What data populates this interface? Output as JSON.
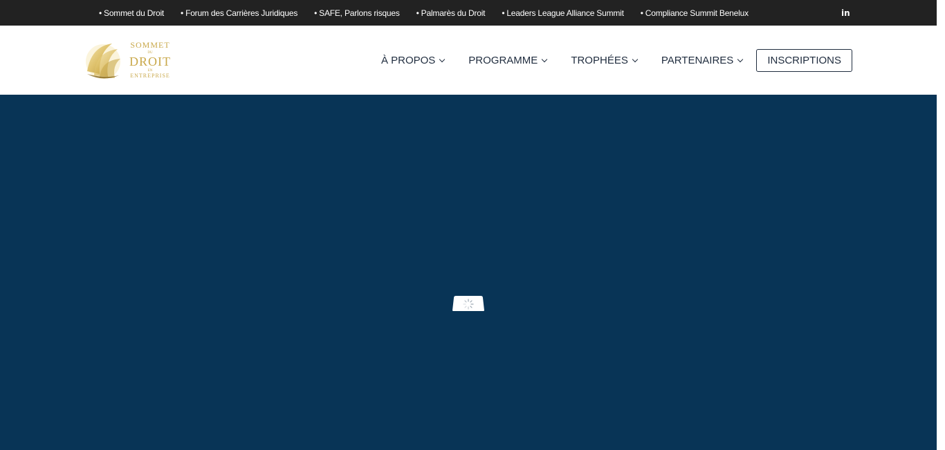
{
  "topbar": {
    "links": [
      {
        "bullet": "•",
        "label": "Sommet du Droit"
      },
      {
        "bullet": "•",
        "label": "Forum des Carrières Juridiques"
      },
      {
        "bullet": "•",
        "label": "SAFE, Parlons risques"
      },
      {
        "bullet": "•",
        "label": "Palmarès du Droit"
      },
      {
        "bullet": "•",
        "label": "Leaders League Alliance Summit"
      },
      {
        "bullet": "•",
        "label": "Compliance Summit Benelux"
      }
    ],
    "social": {
      "icon": "linkedin-icon",
      "label": "in"
    }
  },
  "header": {
    "logo": {
      "line1": "SOMMET",
      "line2": "DU",
      "line3": "DROIT",
      "line4": "EN",
      "line5": "ENTREPRISE"
    },
    "nav": [
      {
        "label": "À PROPOS",
        "icon": "chevron-down-icon"
      },
      {
        "label": "PROGRAMME",
        "icon": "chevron-down-icon"
      },
      {
        "label": "TROPHÉES",
        "icon": "chevron-down-icon"
      },
      {
        "label": "PARTENAIRES",
        "icon": "chevron-down-icon"
      }
    ],
    "cta_label": "INSCRIPTIONS"
  },
  "hero": {
    "loader_icon": "loading-spinner-icon"
  },
  "colors": {
    "topbar_bg": "#222222",
    "hero_bg": "#083456",
    "nav_text": "#1f2c3e",
    "logo_gold": "#c9a84a"
  }
}
